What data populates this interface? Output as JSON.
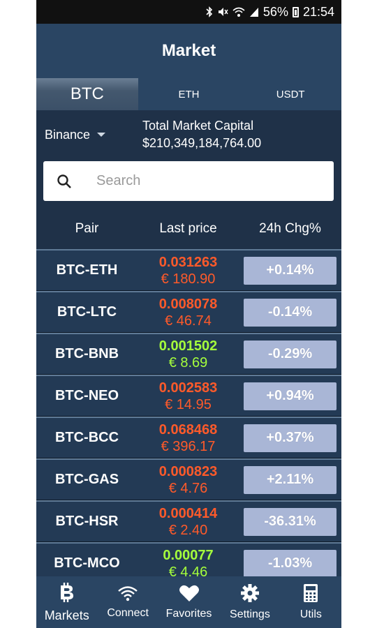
{
  "status_bar": {
    "battery": "56%",
    "time": "21:54"
  },
  "header": {
    "title": "Market"
  },
  "tabs": [
    {
      "label": "BTC",
      "active": true
    },
    {
      "label": "ETH",
      "active": false
    },
    {
      "label": "USDT",
      "active": false
    }
  ],
  "exchange": {
    "selected": "Binance"
  },
  "market_cap": {
    "label": "Total Market Capital",
    "value": "$210,349,184,764.00"
  },
  "search": {
    "placeholder": "Search"
  },
  "columns": {
    "pair": "Pair",
    "last_price": "Last price",
    "change": "24h Chg%"
  },
  "colors": {
    "up": "#ff5a2a",
    "down": "#a5ff3c",
    "chg_bg": "#a9b6d6"
  },
  "rows": [
    {
      "pair": "BTC-ETH",
      "price": "0.031263",
      "eur": "€ 180.90",
      "change": "+0.14%",
      "trend": "up"
    },
    {
      "pair": "BTC-LTC",
      "price": "0.008078",
      "eur": "€ 46.74",
      "change": "-0.14%",
      "trend": "up"
    },
    {
      "pair": "BTC-BNB",
      "price": "0.001502",
      "eur": "€ 8.69",
      "change": "-0.29%",
      "trend": "down"
    },
    {
      "pair": "BTC-NEO",
      "price": "0.002583",
      "eur": "€ 14.95",
      "change": "+0.94%",
      "trend": "up"
    },
    {
      "pair": "BTC-BCC",
      "price": "0.068468",
      "eur": "€ 396.17",
      "change": "+0.37%",
      "trend": "up"
    },
    {
      "pair": "BTC-GAS",
      "price": "0.000823",
      "eur": "€ 4.76",
      "change": "+2.11%",
      "trend": "up"
    },
    {
      "pair": "BTC-HSR",
      "price": "0.000414",
      "eur": "€ 2.40",
      "change": "-36.31%",
      "trend": "up"
    },
    {
      "pair": "BTC-MCO",
      "price": "0.00077",
      "eur": "€ 4.46",
      "change": "-1.03%",
      "trend": "down"
    }
  ],
  "nav": [
    {
      "label": "Markets",
      "icon": "bitcoin-icon"
    },
    {
      "label": "Connect",
      "icon": "wifi-icon"
    },
    {
      "label": "Favorites",
      "icon": "heart-icon"
    },
    {
      "label": "Settings",
      "icon": "gear-icon"
    },
    {
      "label": "Utils",
      "icon": "calculator-icon"
    }
  ]
}
